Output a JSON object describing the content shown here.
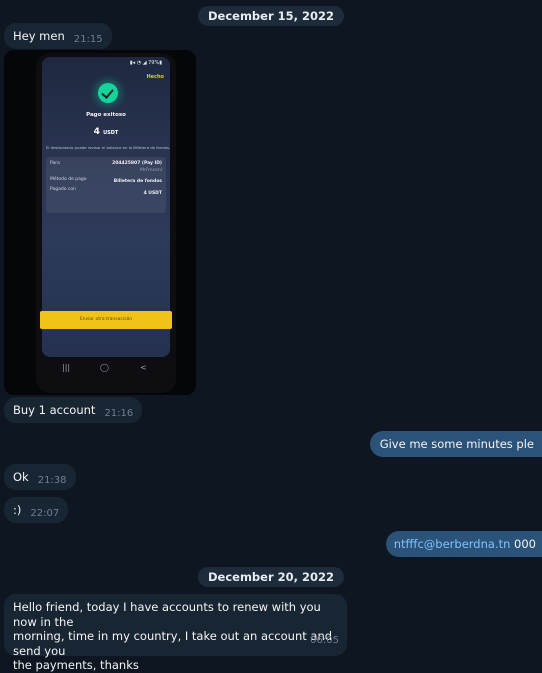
{
  "dates": [
    "December 15, 2022",
    "December 20, 2022"
  ],
  "messages": [
    {
      "text": "Hey men",
      "time": "21:15"
    },
    {
      "text": "Buy 1 account",
      "time": "21:16"
    },
    {
      "text": "Give me some minutes ple"
    },
    {
      "text": "Ok",
      "time": "21:38"
    },
    {
      "text": ":)",
      "time": "22:07"
    },
    {
      "link": "ntfffc@berberdna.tn",
      "text": "000"
    },
    {
      "lines": [
        "Hello friend, today I have accounts to renew with you now in the",
        "morning, time in my country, I take out an account and send you",
        "the payments, thanks"
      ],
      "time": "06:05"
    }
  ],
  "photo": {
    "status": "▮◂ ◔ ◢ 79%▮",
    "done": "Hecho",
    "title": "Pago exitoso",
    "amount": "4",
    "currency": "USDT",
    "description": "El destinatario puede revisar el balance en la Billetera de fondos.",
    "details": [
      {
        "label": "Para",
        "value": "204425807 (Pay ID)",
        "sub": "MrFrnconI"
      },
      {
        "label": "Método de pago",
        "value": "Billetera de fondos"
      },
      {
        "label": "Pagado con",
        "value": "4 USDT"
      }
    ],
    "button": "Enviar otra transacción",
    "nav_icons": [
      "|||",
      "◯",
      "<"
    ]
  },
  "colors": {
    "background": "#0e1621",
    "incoming": "#182533",
    "outgoing": "#2b5278",
    "accent": "#f0c316",
    "success": "#14d39b"
  }
}
